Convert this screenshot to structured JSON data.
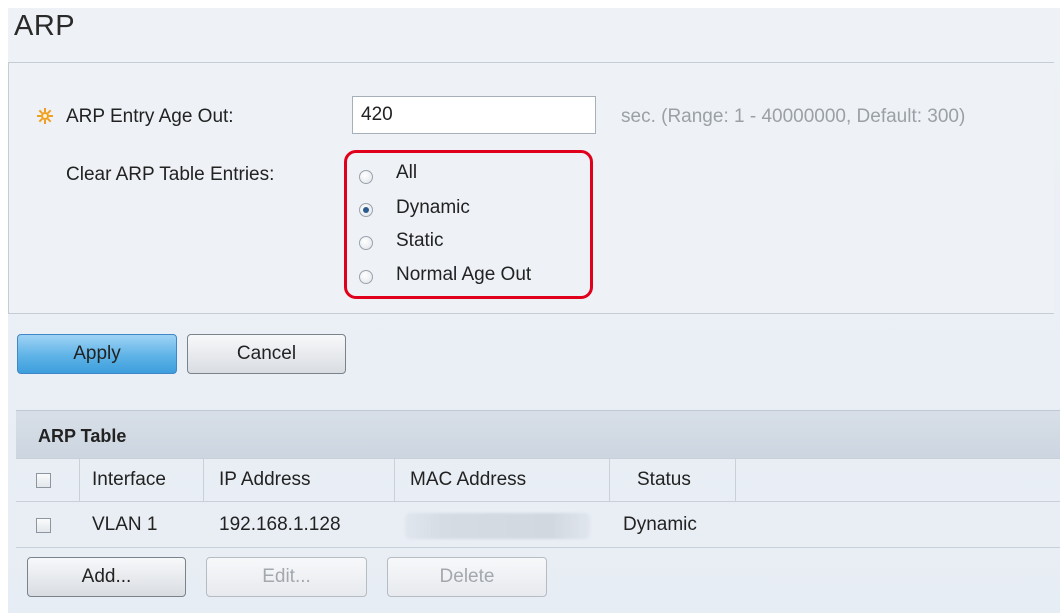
{
  "page": {
    "title": "ARP"
  },
  "settings": {
    "age_out_label": "ARP Entry Age Out:",
    "age_out_value": "420",
    "age_out_hint": "sec. (Range: 1 - 40000000, Default: 300)",
    "clear_label": "Clear ARP Table Entries:",
    "clear_options": [
      {
        "label": "All",
        "checked": false
      },
      {
        "label": "Dynamic",
        "checked": true
      },
      {
        "label": "Static",
        "checked": false
      },
      {
        "label": "Normal Age Out",
        "checked": false
      }
    ]
  },
  "actions": {
    "apply_label": "Apply",
    "cancel_label": "Cancel"
  },
  "arp_table": {
    "title": "ARP Table",
    "columns": [
      "Interface",
      "IP Address",
      "MAC Address",
      "Status"
    ],
    "rows": [
      {
        "interface": "VLAN 1",
        "ip": "192.168.1.128",
        "mac": "",
        "status": "Dynamic"
      }
    ],
    "buttons": {
      "add": "Add...",
      "edit": "Edit...",
      "delete": "Delete"
    }
  },
  "colors": {
    "highlight": "#e0001b",
    "primary_button": "#5eb3e7",
    "required_icon": "#f0a020"
  }
}
